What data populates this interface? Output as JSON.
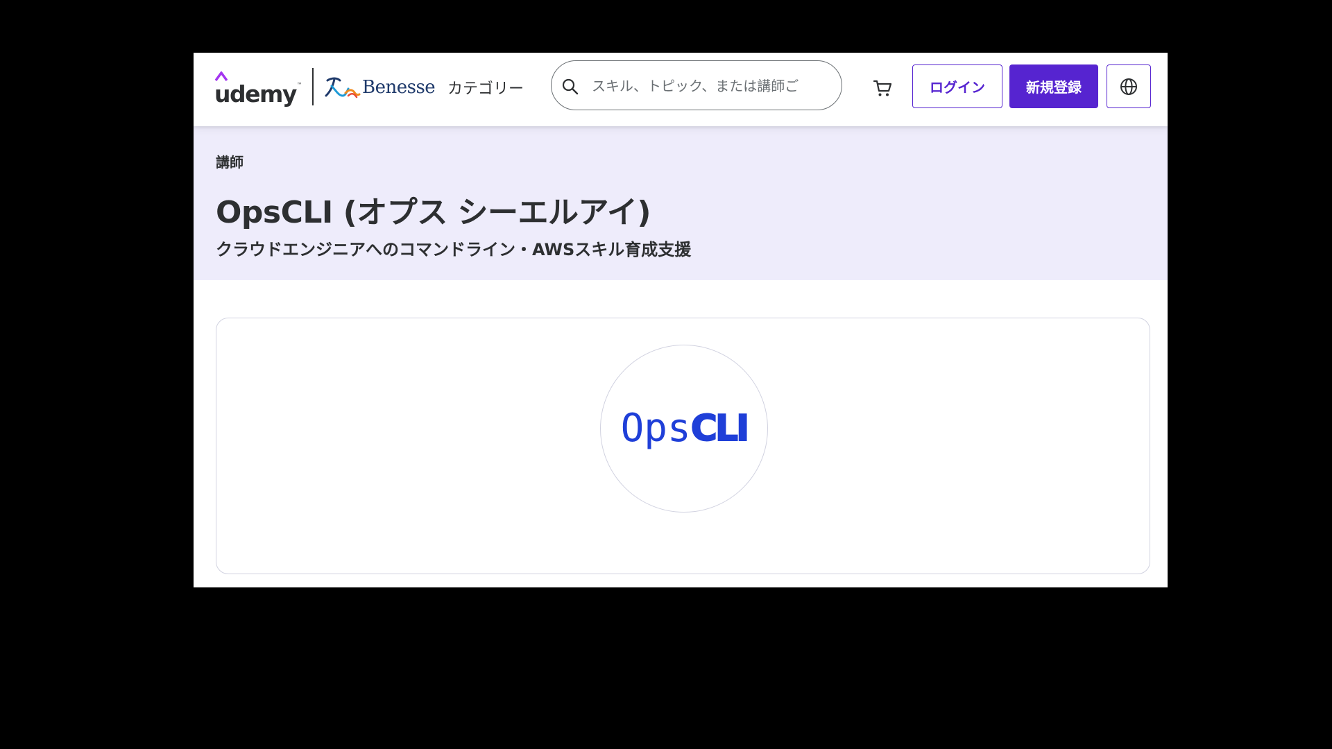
{
  "header": {
    "logo_text": "udemy",
    "logo_tm": "™",
    "partner_logo_text": "Benesse",
    "categories_label": "カテゴリー",
    "search_placeholder": "スキル、トピック、または講師ご",
    "login_label": "ログイン",
    "signup_label": "新規登録"
  },
  "hero": {
    "role": "講師",
    "name": "OpsCLI (オプス シーエルアイ)",
    "tagline": "クラウドエンジニアへのコマンドライン・AWSスキル育成支援"
  },
  "profile": {
    "avatar_text_ops": "Ops",
    "avatar_text_cli": "CLI"
  },
  "icons": {
    "search": "search-icon",
    "cart": "cart-icon",
    "language": "globe-icon"
  },
  "colors": {
    "brand_purple": "#5624d0",
    "hero_background": "#eeecfb",
    "text_primary": "#2d2f31",
    "avatar_text": "#1f3fd8"
  }
}
